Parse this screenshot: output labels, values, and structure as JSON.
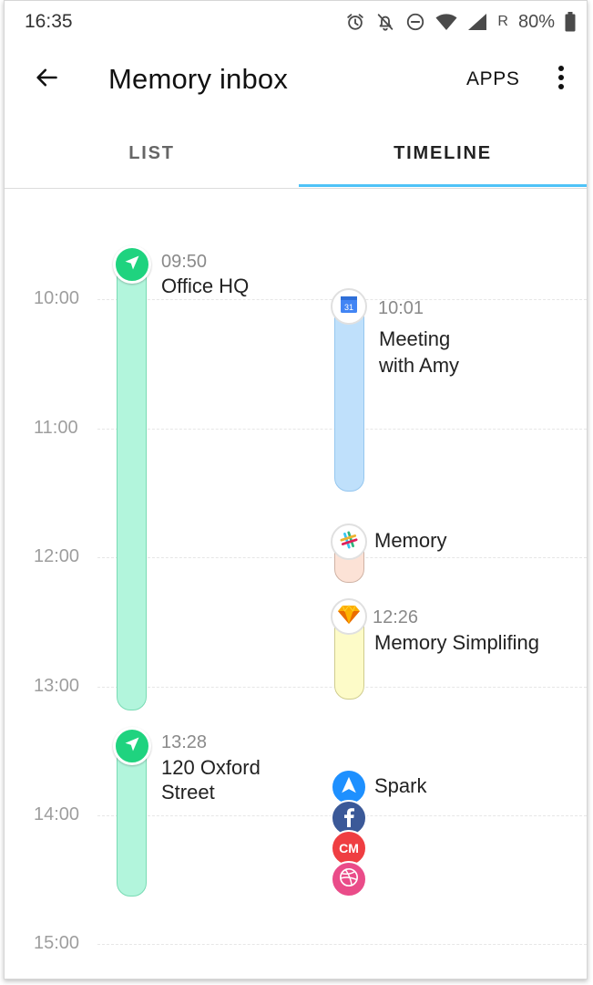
{
  "status_bar": {
    "time": "16:35",
    "network_indicator": "R",
    "battery": "80%",
    "icons": [
      "alarm-icon",
      "bell-off-icon",
      "do-not-disturb-icon",
      "wifi-icon",
      "signal-icon",
      "battery-icon"
    ]
  },
  "app_bar": {
    "title": "Memory inbox",
    "apps_label": "APPS",
    "back_icon": "arrow-left-icon",
    "more_icon": "more-vert-icon"
  },
  "tabs": {
    "list_label": "LIST",
    "timeline_label": "TIMELINE",
    "selected": "TIMELINE",
    "accent_color": "#4fc3f7"
  },
  "timeline": {
    "hours": [
      "10:00",
      "11:00",
      "12:00",
      "13:00",
      "14:00",
      "15:00"
    ],
    "locations": [
      {
        "time": "09:50",
        "title": "Office HQ",
        "icon": "location-arrow-icon",
        "color": "#1fd37f"
      },
      {
        "time": "13:28",
        "title": "120 Oxford Street",
        "line1": "120 Oxford",
        "line2": "Street",
        "icon": "location-arrow-icon",
        "color": "#1fd37f"
      }
    ],
    "events": [
      {
        "time": "10:01",
        "title": "Meeting with Amy",
        "line1": "Meeting",
        "line2": "with Amy",
        "icon": "google-calendar-icon",
        "calendar_day": "31",
        "color": "#bfe0fb"
      },
      {
        "time": "",
        "title": "Memory",
        "icon": "slack-icon",
        "color": "#fce2d6"
      },
      {
        "time": "12:26",
        "title": "Memory Simplifing",
        "icon": "sketch-icon",
        "color": "#fdfbc8"
      }
    ],
    "app_group": {
      "label": "Spark",
      "icons": [
        "spark-icon",
        "facebook-icon",
        "cm-icon",
        "dribbble-icon"
      ],
      "cm_text": "CM"
    }
  }
}
